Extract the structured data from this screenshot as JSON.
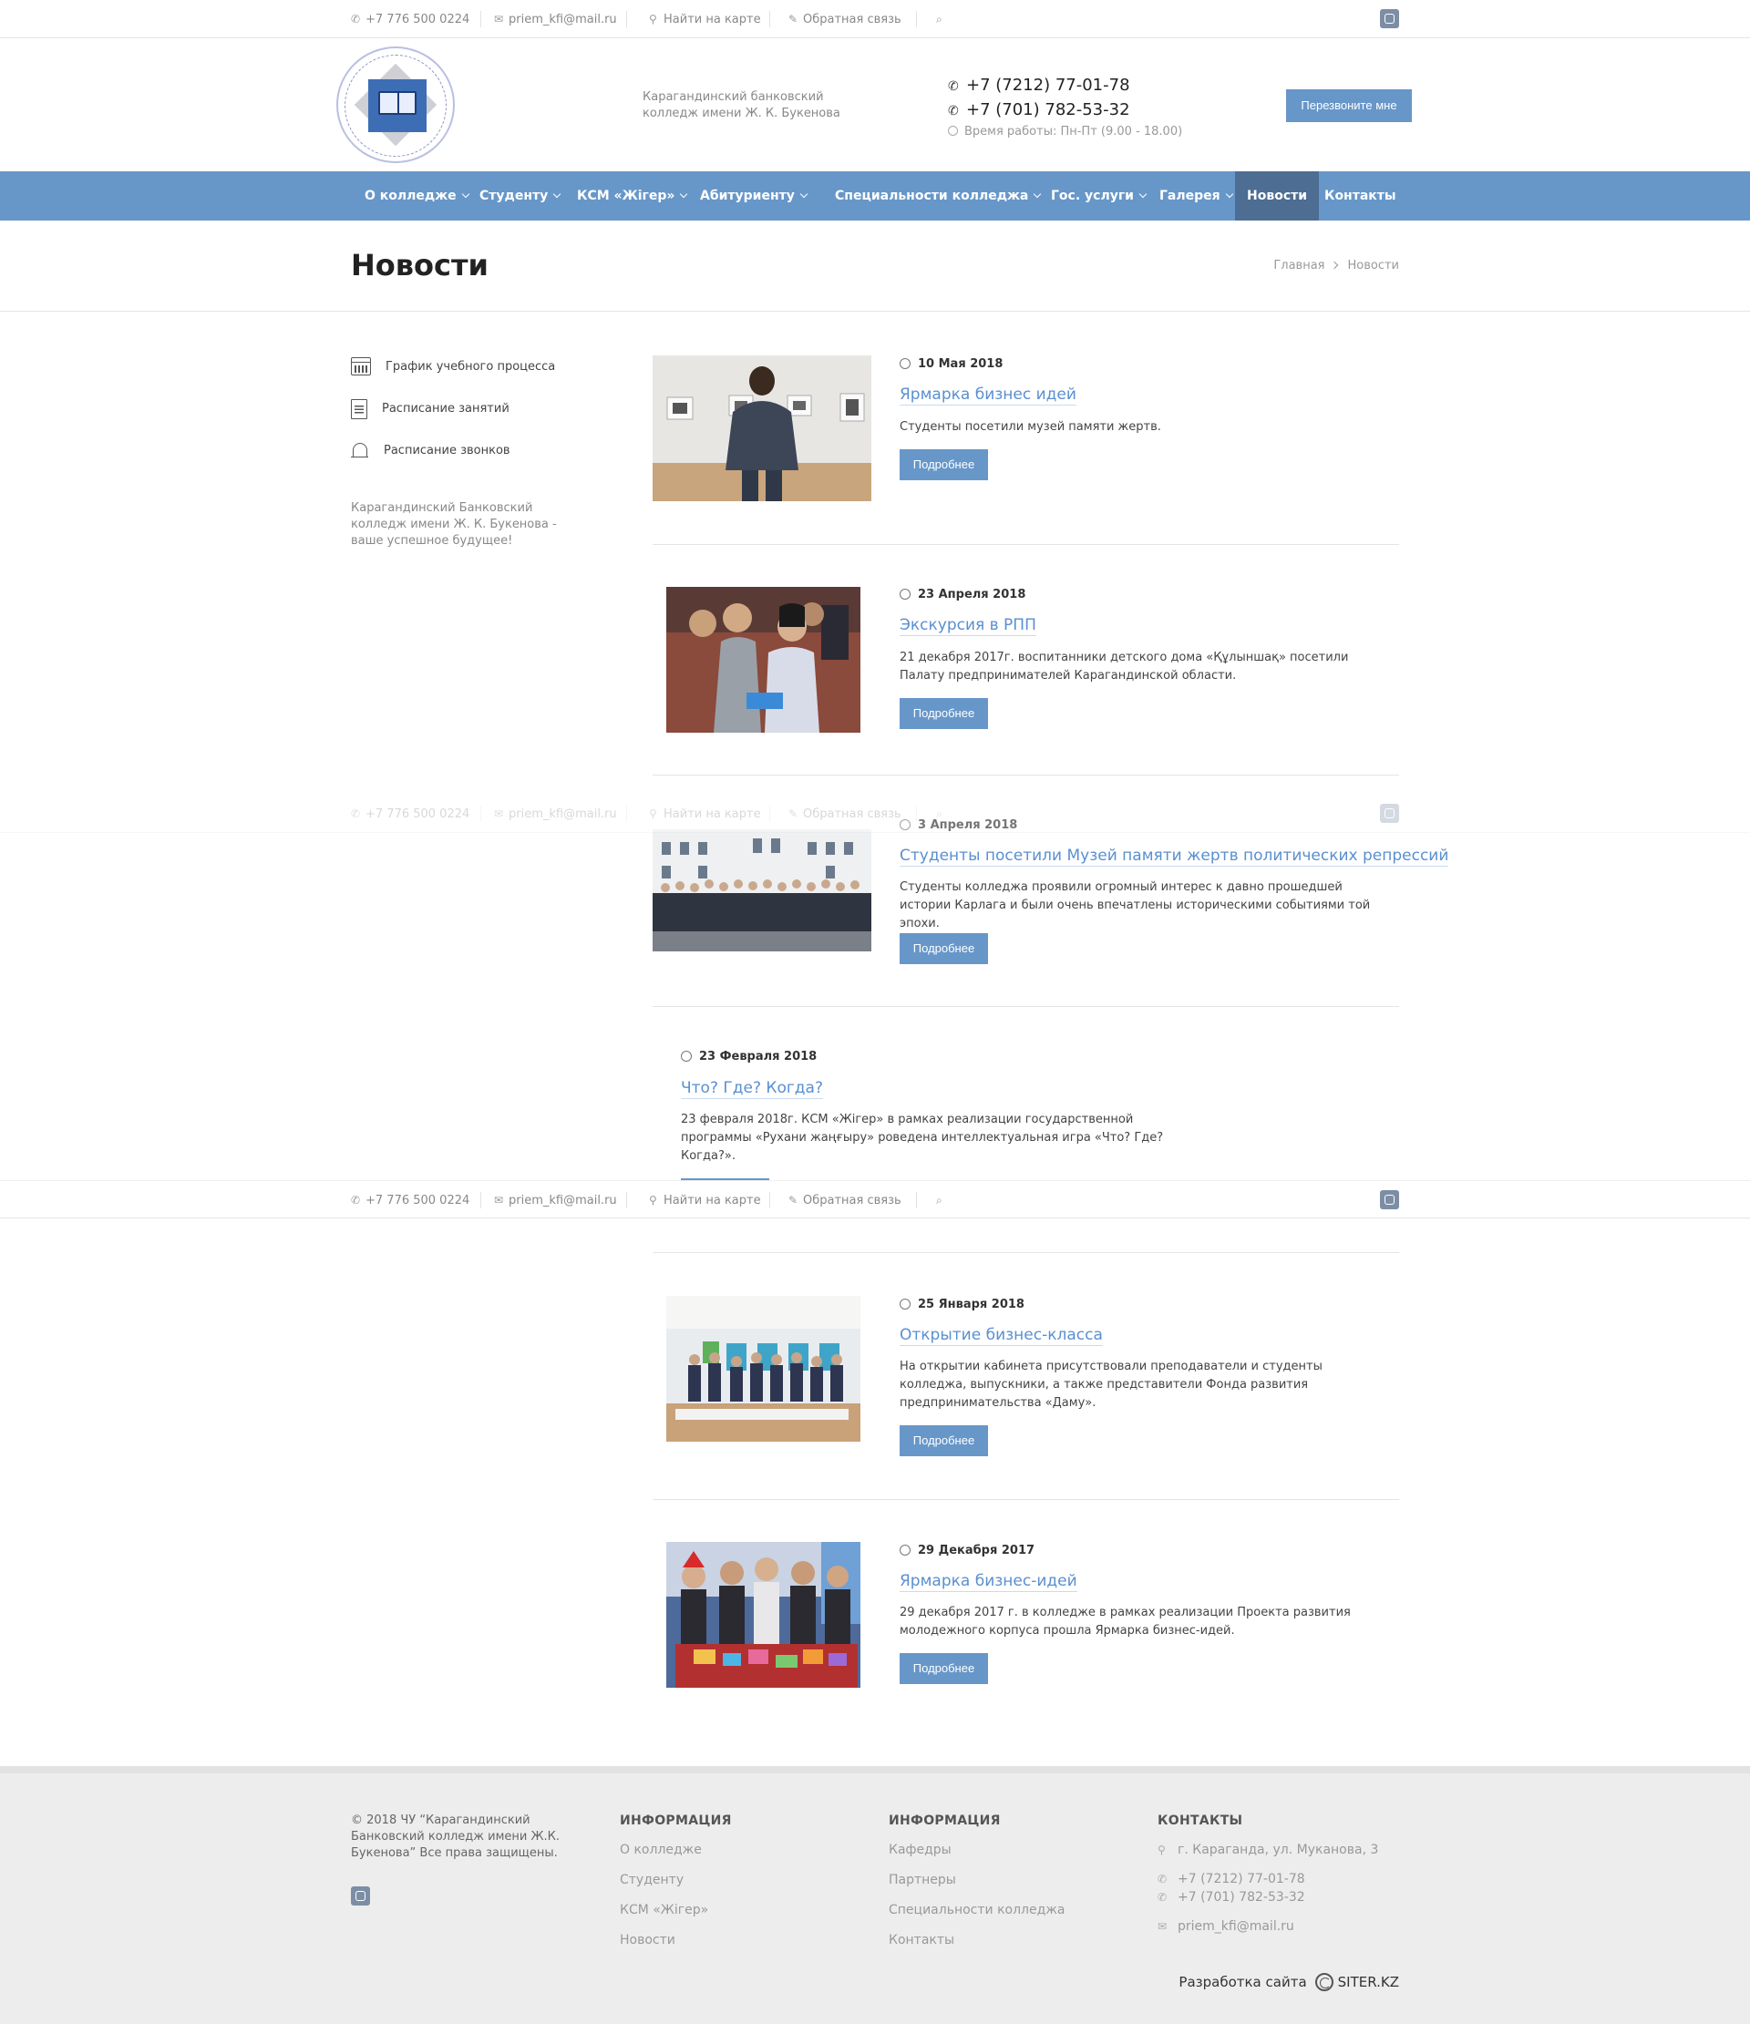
{
  "topbar": {
    "phone": "+7 776 500 0224",
    "email": "priem_kfi@mail.ru",
    "map_link": "Найти на карте",
    "feedback_link": "Обратная связь"
  },
  "header": {
    "college_name": "Карагандинский банковский колледж имени Ж. К. Букенова",
    "phone1": "+7 (7212) 77-01-78",
    "phone2": "+7 (701) 782-53-32",
    "hours": "Время работы: Пн-Пт (9.00 - 18.00)",
    "callback_label": "Перезвоните мне"
  },
  "nav": [
    {
      "label": "О колледже"
    },
    {
      "label": "Студенту"
    },
    {
      "label": "КСМ «Жігер»"
    },
    {
      "label": "Абитуриенту"
    },
    {
      "label": "Специальности колледжа"
    },
    {
      "label": "Гос. услуги"
    },
    {
      "label": "Галерея"
    },
    {
      "label": "Новости"
    },
    {
      "label": "Контакты"
    }
  ],
  "page": {
    "title": "Новости",
    "breadcrumb_home": "Главная",
    "breadcrumb_current": "Новости"
  },
  "sidebar": {
    "links": [
      {
        "label": "График учебного процесса",
        "icon": "calendar-icon"
      },
      {
        "label": "Расписание занятий",
        "icon": "document-icon"
      },
      {
        "label": "Расписание звонков",
        "icon": "bell-icon"
      }
    ],
    "tagline": "Карагандинский Банковский колледж имени Ж. К. Букенова - ваше успешное будущее!"
  },
  "news": [
    {
      "date": "10 Мая 2018",
      "title": "Ярмарка бизнес идей",
      "text": "Студенты посетили музей памяти жертв.",
      "more": "Подробнее"
    },
    {
      "date": "23 Апреля 2018",
      "title": "Экскурсия в РПП",
      "text": "21 декабря 2017г. воспитанники детского дома «Құлыншақ» посетили Палату предпринимателей Карагандинской области.",
      "more": "Подробнее"
    },
    {
      "date": "3 Апреля 2018",
      "title": "Студенты посетили Музей памяти жертв политических репрессий",
      "text": "Студенты колледжа проявили огромный интерес к давно прошедшей истории Карлага и были очень впечатлены историческими событиями той эпохи.",
      "more": "Подробнее"
    },
    {
      "date": "23 Февраля 2018",
      "title": "Что? Где? Когда?",
      "text": "23 февраля 2018г. КСМ «Жігер» в рамках реализации государственной программы «Рухани жаңғыру» роведена интеллектуальная игра «Что? Где? Когда?».",
      "more": ""
    },
    {
      "date": "25 Января 2018",
      "title": "Открытие бизнес-класса",
      "text": "На открытии кабинета присутствовали преподаватели и студенты колледжа, выпускники, а также представители Фонда развития предпринимательства «Даму».",
      "more": "Подробнее"
    },
    {
      "date": "29 Декабря 2017",
      "title": "Ярмарка бизнес-идей",
      "text": "29 декабря 2017 г. в колледже в рамках реализации Проекта развития молодежного корпуса прошла Ярмарка бизнес-идей.",
      "more": "Подробнее"
    }
  ],
  "footer": {
    "copyright": "© 2018 ЧУ “Карагандинский Банковский колледж имени Ж.К. Букенова” Все права защищены.",
    "col1": {
      "heading": "ИНФОРМАЦИЯ",
      "links": [
        "О колледже",
        "Студенту",
        "КСМ «Жігер»",
        "Новости"
      ]
    },
    "col2": {
      "heading": "ИНФОРМАЦИЯ",
      "links": [
        "Кафедры",
        "Партнеры",
        "Специальности колледжа",
        "Контакты"
      ]
    },
    "col3": {
      "heading": "КОНТАКТЫ",
      "address": "г. Караганда, ул. Муканова, 3",
      "phone1": "+7 (7212) 77-01-78",
      "phone2": "+7 (701) 782-53-32",
      "email": "priem_kfi@mail.ru"
    },
    "developer_label": "Разработка сайта",
    "developer_name": "SITER.KZ"
  },
  "colors": {
    "nav_bg": "#6797c9",
    "nav_active": "#4d6d92",
    "link": "#5a8fd0",
    "footer_bg": "#ededed"
  }
}
